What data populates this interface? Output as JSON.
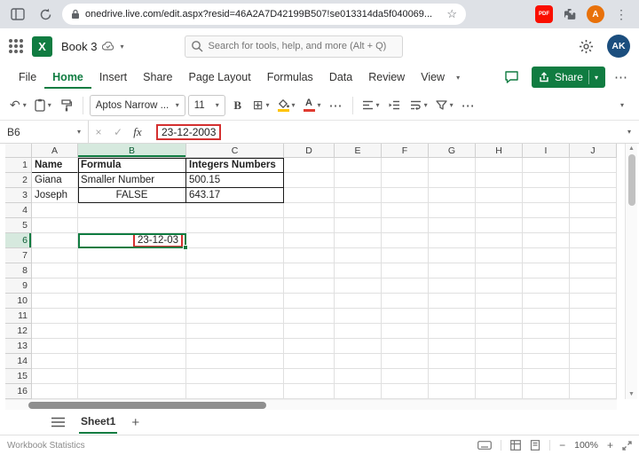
{
  "browser": {
    "url_text": "onedrive.live.com/edit.aspx?resid=46A2A7D42199B507!se013314da5f040069...",
    "pdf_badge": "PDF",
    "avatar_letter": "A"
  },
  "app_header": {
    "workbook_title": "Book 3",
    "search_placeholder": "Search for tools, help, and more (Alt + Q)",
    "avatar_initials": "AK"
  },
  "menu_bar": {
    "items": [
      "File",
      "Home",
      "Insert",
      "Share",
      "Page Layout",
      "Formulas",
      "Data",
      "Review",
      "View"
    ],
    "active_item": "Home",
    "share_button_label": "Share"
  },
  "toolbar": {
    "font_name": "Aptos Narrow ...",
    "font_size": "11",
    "bold_label": "B",
    "font_color_letter": "A"
  },
  "formula_bar": {
    "name_box_value": "B6",
    "cancel_glyph": "×",
    "enter_glyph": "✓",
    "fx_label": "fx",
    "formula_text": "23-12-2003"
  },
  "grid": {
    "column_headers": [
      "A",
      "B",
      "C",
      "D",
      "E",
      "F",
      "G",
      "H",
      "I",
      "J"
    ],
    "row_count": 16,
    "selection": {
      "cell": "B6",
      "column": "B",
      "row": 6
    },
    "cells": {
      "A1": {
        "text": "Name",
        "bold": true,
        "borders": "b"
      },
      "B1": {
        "text": "Formula",
        "bold": true,
        "borders": "tlrb"
      },
      "C1": {
        "text": "Integers Numbers",
        "bold": true,
        "borders": "trb"
      },
      "A2": {
        "text": "Giana"
      },
      "B2": {
        "text": "Smaller Number",
        "borders": "lrb"
      },
      "C2": {
        "text": "500.15",
        "borders": "rb"
      },
      "A3": {
        "text": "Joseph"
      },
      "B3": {
        "text": "FALSE",
        "align": "center",
        "borders": "lrb"
      },
      "C3": {
        "text": "643.17",
        "borders": "rb"
      },
      "B6": {
        "text": "23-12-03",
        "align": "right",
        "red_annotation": true
      }
    }
  },
  "sheet_tabs": {
    "active_tab": "Sheet1",
    "add_label": "+"
  },
  "status_bar": {
    "left_label": "Workbook Statistics",
    "zoom_level": "100%"
  },
  "colors": {
    "excel_green": "#107C41",
    "annotation_red": "#D43030",
    "browser_avatar": "#E8710A",
    "account_avatar": "#1B4E7E",
    "adobe_red": "#FA0F00"
  }
}
